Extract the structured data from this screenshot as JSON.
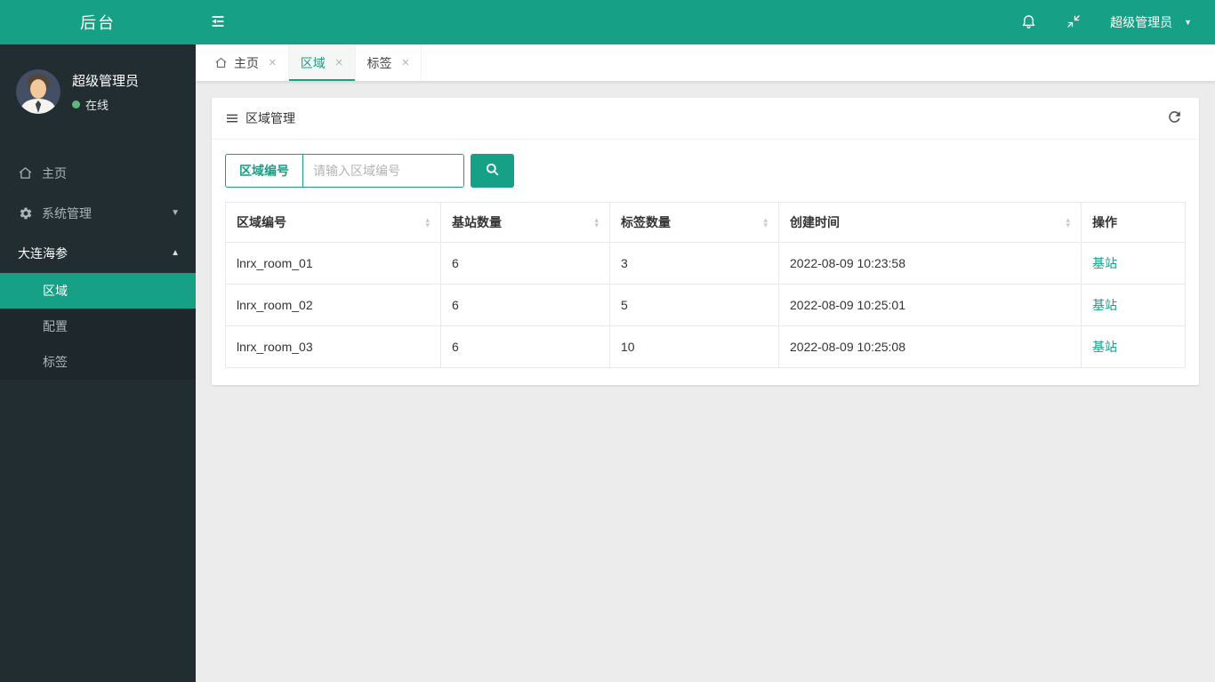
{
  "app": {
    "logo_text": "后台"
  },
  "navbar": {
    "user_name": "超级管理员"
  },
  "sidebar": {
    "user": {
      "name": "超级管理员",
      "status_label": "在线"
    },
    "items": [
      {
        "label": "主页",
        "icon": "home-icon"
      },
      {
        "label": "系统管理",
        "icon": "gear-icon",
        "caret": "down"
      },
      {
        "label": "大连海参",
        "caret": "up"
      }
    ],
    "submenu": [
      {
        "label": "区域",
        "active": true
      },
      {
        "label": "配置",
        "active": false
      },
      {
        "label": "标签",
        "active": false
      }
    ]
  },
  "tabs": [
    {
      "label": "主页",
      "icon": "home-icon",
      "active": false
    },
    {
      "label": "区域",
      "active": true
    },
    {
      "label": "标签",
      "active": false
    }
  ],
  "panel": {
    "title": "区域管理"
  },
  "search": {
    "field_label": "区域编号",
    "placeholder": "请输入区域编号"
  },
  "table": {
    "columns": [
      {
        "label": "区域编号",
        "sortable": true
      },
      {
        "label": "基站数量",
        "sortable": true
      },
      {
        "label": "标签数量",
        "sortable": true
      },
      {
        "label": "创建时间",
        "sortable": true
      },
      {
        "label": "操作",
        "sortable": false
      }
    ],
    "rows": [
      [
        "lnrx_room_01",
        "6",
        "3",
        "2022-08-09 10:23:58",
        "基站"
      ],
      [
        "lnrx_room_02",
        "6",
        "5",
        "2022-08-09 10:25:01",
        "基站"
      ],
      [
        "lnrx_room_03",
        "6",
        "10",
        "2022-08-09 10:25:08",
        "基站"
      ]
    ]
  },
  "colors": {
    "accent": "#16a085",
    "sidebar_bg": "#222d32",
    "submenu_bg": "#1e282c",
    "page_bg": "#ececec",
    "online_dot": "#5fb878",
    "link": "#16a085"
  }
}
